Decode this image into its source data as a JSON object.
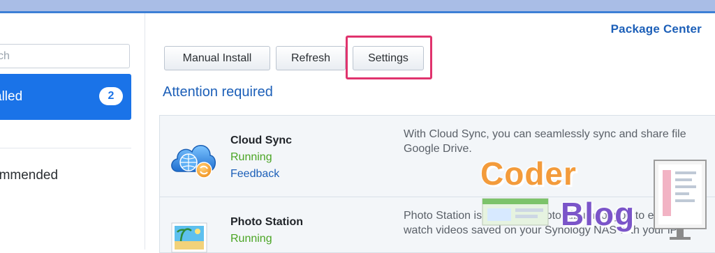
{
  "window": {
    "title": "Package Center"
  },
  "sidebar": {
    "search_placeholder": "ch",
    "items": [
      {
        "label": "alled",
        "badge": "2",
        "selected": true
      },
      {
        "label": "ommended",
        "selected": false
      }
    ]
  },
  "toolbar": {
    "manual_install_label": "Manual Install",
    "refresh_label": "Refresh",
    "settings_label": "Settings"
  },
  "main": {
    "section_title": "Attention required",
    "packages": [
      {
        "name": "Cloud Sync",
        "status": "Running",
        "link": "Feedback",
        "description_line1": "With Cloud Sync, you can seamlessly sync and share file",
        "description_line2": "Google Drive."
      },
      {
        "name": "Photo Station",
        "status": "Running",
        "description_line1": "Photo Station is an online photo album for you to easily",
        "description_line2": "watch videos saved on your Synology NAS with your iPh"
      }
    ]
  },
  "watermark": {
    "word1": "Coder",
    "word2": "Blog"
  },
  "colors": {
    "accent": "#1a73e8",
    "title_blue": "#1c5fb8",
    "status_green": "#4aa524",
    "highlight_pink": "#e0336d",
    "watermark_orange": "#f39b3b",
    "watermark_purple": "#7b55c9"
  },
  "icons": {
    "cloud_sync": "cloud-sync-icon",
    "photo_station": "photo-station-icon"
  }
}
